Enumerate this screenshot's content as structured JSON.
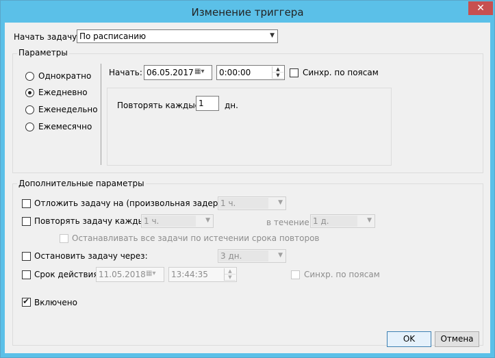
{
  "window": {
    "title": "Изменение триггера",
    "close_glyph": "✕"
  },
  "begin_task": {
    "label": "Начать задачу:",
    "value": "По расписанию"
  },
  "parameters": {
    "legend": "Параметры",
    "schedule_options": [
      {
        "label": "Однократно",
        "checked": false
      },
      {
        "label": "Ежедневно",
        "checked": true
      },
      {
        "label": "Еженедельно",
        "checked": false
      },
      {
        "label": "Ежемесячно",
        "checked": false
      }
    ],
    "start_label": "Начать:",
    "start_date": "06.05.2017",
    "start_time": "0:00:00",
    "sync_label": "Синхр. по поясам",
    "repeat_every_label": "Повторять каждые:",
    "repeat_every_value": "1",
    "repeat_unit": "дн."
  },
  "advanced": {
    "legend": "Дополнительные параметры",
    "delay_label": "Отложить задачу на (произвольная задержка):",
    "delay_value": "1 ч.",
    "repeat_label": "Повторять задачу каждые:",
    "repeat_value": "1 ч.",
    "duration_label": "в течение:",
    "duration_value": "1 д.",
    "stop_all_label": "Останавливать все задачи по истечении срока повторов",
    "stop_label": "Остановить задачу через:",
    "stop_value": "3 дн.",
    "expire_label": "Срок действия:",
    "expire_date": "11.05.2018",
    "expire_time": "13:44:35",
    "expire_sync_label": "Синхр. по поясам",
    "enabled_label": "Включено"
  },
  "buttons": {
    "ok": "OK",
    "cancel": "Отмена"
  },
  "icons": {
    "calendar": "calendar-icon",
    "dropdown": "chevron-down-icon"
  },
  "colors": {
    "titlebar": "#5bc0e8",
    "close": "#c75050",
    "client": "#f0f0f0",
    "default_button": "#3c7fb1"
  }
}
